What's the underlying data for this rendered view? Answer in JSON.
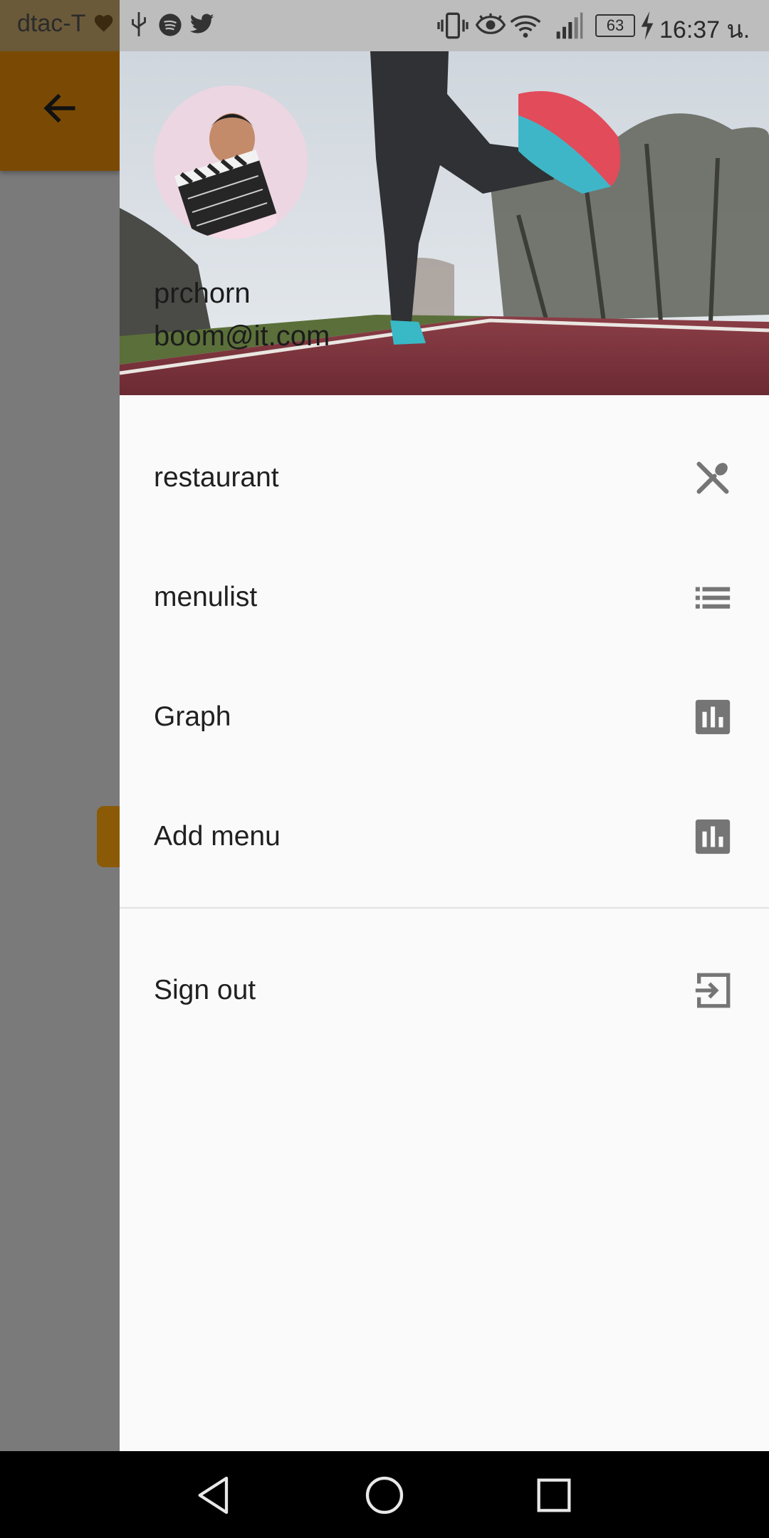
{
  "status_bar": {
    "carrier": "dtac-T",
    "battery": "63",
    "time": "16:37 น.",
    "icons": [
      "heart-icon",
      "usb-icon",
      "spotify-icon",
      "twitter-icon",
      "vibrate-icon",
      "eye-icon",
      "wifi-icon",
      "signal-icon",
      "battery-icon",
      "charging-icon"
    ]
  },
  "app": {
    "back_icon": "back-arrow-icon"
  },
  "drawer": {
    "header": {
      "name": "prchorn",
      "email": "boom@it.com"
    },
    "items": [
      {
        "label": "restaurant",
        "icon": "utensils-icon"
      },
      {
        "label": "menulist",
        "icon": "list-icon"
      },
      {
        "label": "Graph",
        "icon": "bar-chart-icon"
      },
      {
        "label": "Add menu",
        "icon": "bar-chart-icon"
      }
    ],
    "signout": {
      "label": "Sign out",
      "icon": "exit-icon"
    }
  },
  "nav_bar": {
    "buttons": [
      "back-triangle-icon",
      "home-circle-icon",
      "recents-square-icon"
    ]
  },
  "colors": {
    "toolbar": "#7a4a05",
    "scrim": "#7a7a7a",
    "drawer_bg": "#fafafa",
    "icon_grey": "#757575"
  }
}
